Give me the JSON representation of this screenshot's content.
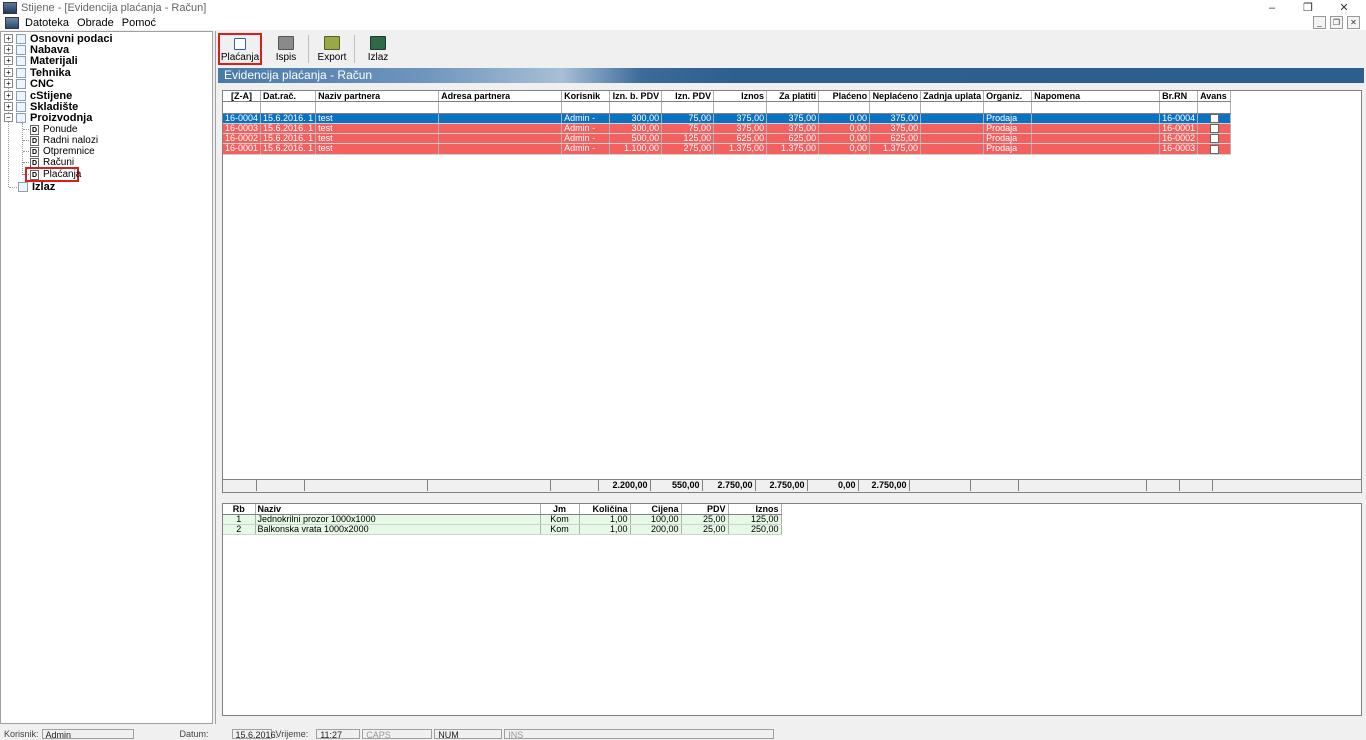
{
  "window": {
    "title": "Stijene - [Evidencija plaćanja - Račun]",
    "controls": [
      "–",
      "❐",
      "✕"
    ]
  },
  "menubar": {
    "items": [
      "Datoteka",
      "Obrade",
      "Pomoć"
    ],
    "mdi_controls": [
      "_",
      "❐",
      "✕"
    ]
  },
  "tree": {
    "nodes": [
      {
        "label": "Osnovni podaci",
        "expander": "+"
      },
      {
        "label": "Nabava",
        "expander": "+"
      },
      {
        "label": "Materijali",
        "expander": "+"
      },
      {
        "label": "Tehnika",
        "expander": "+"
      },
      {
        "label": "CNC",
        "expander": "+"
      },
      {
        "label": "cStijene",
        "expander": "+"
      },
      {
        "label": "Skladište",
        "expander": "+"
      },
      {
        "label": "Proizvodnja",
        "expander": "−"
      }
    ],
    "children": [
      "Ponude",
      "Radni nalozi",
      "Otpremnice",
      "Računi",
      "Plaćanja"
    ],
    "doc_glyph": "D",
    "last": "Izlaz",
    "selected": "Plaćanja"
  },
  "toolbar": {
    "buttons": [
      {
        "label": "Plaćanja",
        "icon": "payments-icon",
        "color": "#3a5fa0"
      },
      {
        "label": "Ispis",
        "icon": "printer-icon",
        "color": "#707070"
      },
      {
        "label": "Export",
        "icon": "export-icon",
        "color": "#7a8a3a"
      },
      {
        "label": "Izlaz",
        "icon": "exit-icon",
        "color": "#2e6a4a"
      }
    ]
  },
  "header": {
    "title": "Evidencija plaćanja - Račun"
  },
  "payments": {
    "columns": [
      "[Z-A]",
      "Dat.rač.",
      "Naziv partnera",
      "Adresa partnera",
      "Korisnik",
      "Izn. b. PDV",
      "Izn. PDV",
      "Iznos",
      "Za platiti",
      "Plaćeno",
      "Neplaćeno",
      "Zadnja uplata",
      "Organiz.",
      "Napomena",
      "Br.RN",
      "Avans"
    ],
    "rows": [
      {
        "status": "selected",
        "cells": [
          "16-0004",
          "15.6.2016. 1",
          "test",
          "",
          "Admin -",
          "300,00",
          "75,00",
          "375,00",
          "375,00",
          "0,00",
          "375,00",
          "",
          "Prodaja",
          "",
          "16-0004"
        ]
      },
      {
        "status": "unpaid",
        "cells": [
          "16-0003",
          "15.6.2016. 1",
          "test",
          "",
          "Admin -",
          "300,00",
          "75,00",
          "375,00",
          "375,00",
          "0,00",
          "375,00",
          "",
          "Prodaja",
          "",
          "16-0001"
        ]
      },
      {
        "status": "unpaid",
        "cells": [
          "16-0002",
          "15.6.2016. 1",
          "test",
          "",
          "Admin -",
          "500,00",
          "125,00",
          "625,00",
          "625,00",
          "0,00",
          "625,00",
          "",
          "Prodaja",
          "",
          "16-0002"
        ]
      },
      {
        "status": "unpaid",
        "cells": [
          "16-0001",
          "15.6.2016. 1",
          "test",
          "",
          "Admin -",
          "1.100,00",
          "275,00",
          "1.375,00",
          "1.375,00",
          "0,00",
          "1.375,00",
          "",
          "Prodaja",
          "",
          "16-0003"
        ]
      }
    ],
    "totals": [
      "",
      "",
      "",
      "",
      "",
      "2.200,00",
      "550,00",
      "2.750,00",
      "2.750,00",
      "0,00",
      "2.750,00",
      "",
      "",
      "",
      "",
      ""
    ]
  },
  "items": {
    "columns": [
      "Rb",
      "Naziv",
      "Jm",
      "Količina",
      "Cijena",
      "PDV",
      "Iznos"
    ],
    "rows": [
      [
        "1",
        "Jednokrilni prozor 1000x1000",
        "Kom",
        "1,00",
        "100,00",
        "25,00",
        "125,00"
      ],
      [
        "2",
        "Balkonska vrata 1000x2000",
        "Kom",
        "1,00",
        "200,00",
        "25,00",
        "250,00"
      ]
    ]
  },
  "statusbar": {
    "user_label": "Korisnik:",
    "user": "Admin",
    "date_label": "Datum:",
    "date": "15.6.2016.",
    "time_label": "Vrijeme:",
    "time": "11:27",
    "caps": "CAPS",
    "num": "NUM",
    "ins": "INS"
  },
  "colors": {
    "selected_row": "#0a72c0",
    "unpaid_row": "#f36060",
    "item_row": "#e6f8e6",
    "banner": "#2d5e90",
    "highlight": "#d81e1e"
  }
}
